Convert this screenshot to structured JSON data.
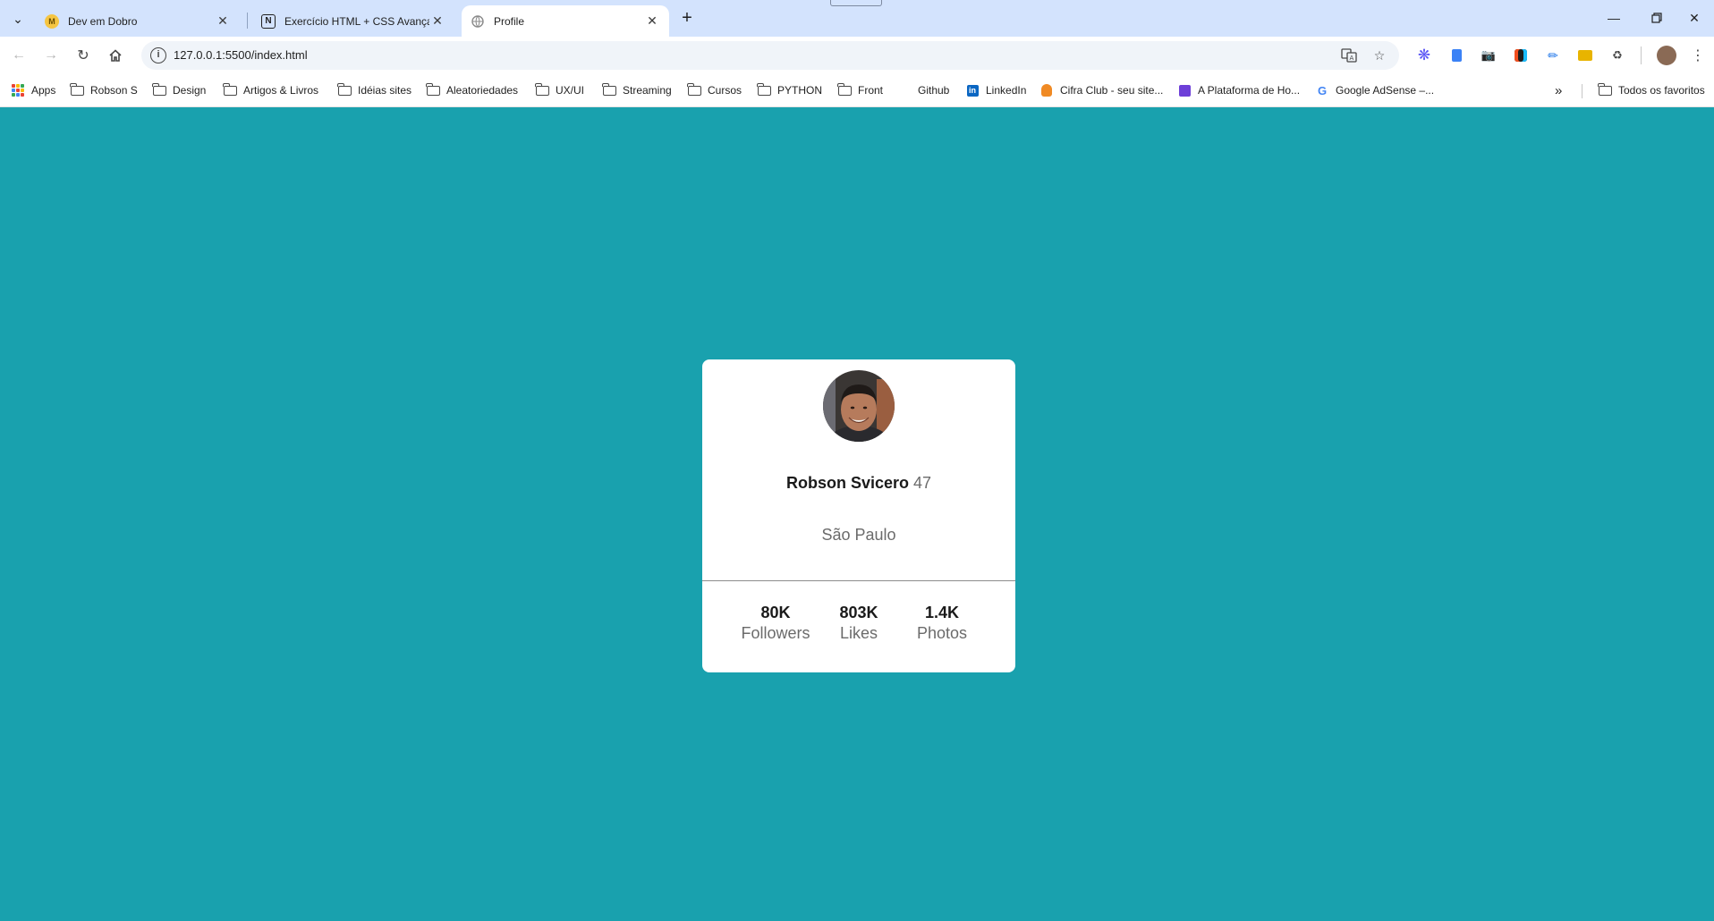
{
  "browser": {
    "tabs": [
      {
        "title": "Dev em Dobro",
        "favicon": "dev-em-dobro-favicon",
        "active": false
      },
      {
        "title": "Exercício HTML + CSS Avançado",
        "favicon": "notion-favicon",
        "active": false
      },
      {
        "title": "Profile",
        "favicon": "globe-favicon",
        "active": true
      }
    ],
    "url": "127.0.0.1:5500/index.html",
    "bookmarks": [
      {
        "label": "Apps",
        "icon": "apps-grid-icon"
      },
      {
        "label": "Robson S",
        "icon": "folder-icon"
      },
      {
        "label": "Design",
        "icon": "folder-icon"
      },
      {
        "label": "Artigos & Livros",
        "icon": "folder-icon"
      },
      {
        "label": "Idéias sites",
        "icon": "folder-icon"
      },
      {
        "label": "Aleatoriedades",
        "icon": "folder-icon"
      },
      {
        "label": "UX/UI",
        "icon": "folder-icon"
      },
      {
        "label": "Streaming",
        "icon": "folder-icon"
      },
      {
        "label": "Cursos",
        "icon": "folder-icon"
      },
      {
        "label": "PYTHON",
        "icon": "folder-icon"
      },
      {
        "label": "Front",
        "icon": "folder-icon"
      },
      {
        "label": "Github",
        "icon": "none"
      },
      {
        "label": "LinkedIn",
        "icon": "linkedin-icon"
      },
      {
        "label": "Cifra Club - seu site...",
        "icon": "cifra-club-icon"
      },
      {
        "label": "A Plataforma de Ho...",
        "icon": "plataforma-icon"
      },
      {
        "label": "Google AdSense –...",
        "icon": "google-icon"
      }
    ],
    "all_bookmarks_label": "Todos os favoritos"
  },
  "profile": {
    "name": "Robson Svicero",
    "age": "47",
    "city": "São Paulo",
    "stats": [
      {
        "value": "80K",
        "label": "Followers"
      },
      {
        "value": "803K",
        "label": "Likes"
      },
      {
        "value": "1.4K",
        "label": "Photos"
      }
    ]
  },
  "colors": {
    "page_background": "#19a1ae",
    "card_background": "#ffffff",
    "tabstrip": "#d3e3fd",
    "text_dark": "#1a1a1a",
    "text_muted": "#6b6b6b"
  }
}
